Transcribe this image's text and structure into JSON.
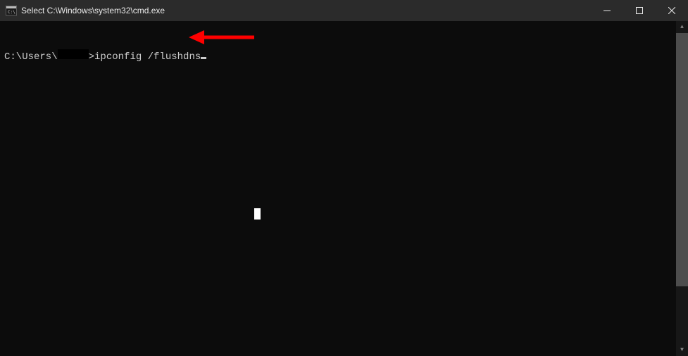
{
  "titlebar": {
    "title": "Select C:\\Windows\\system32\\cmd.exe"
  },
  "console": {
    "prompt_prefix": "C:\\Users\\",
    "prompt_suffix": ">",
    "command": "ipconfig /flushdns"
  }
}
